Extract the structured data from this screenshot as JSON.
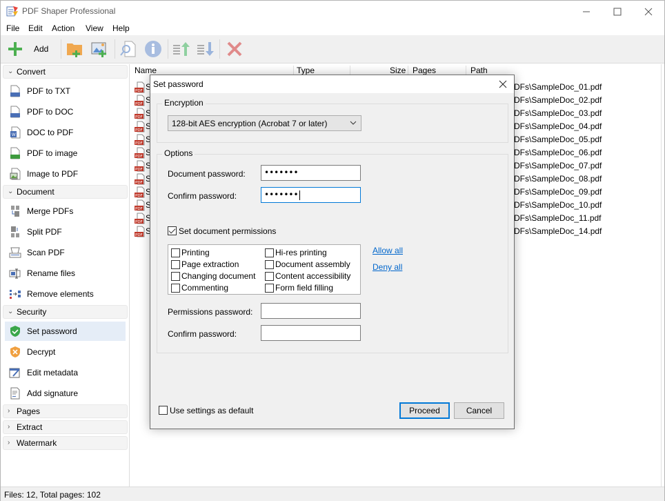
{
  "window": {
    "title": "PDF Shaper Professional",
    "controls": [
      "minimize",
      "maximize",
      "close"
    ]
  },
  "menu": [
    "File",
    "Edit",
    "Action",
    "View",
    "Help"
  ],
  "toolbar": {
    "add_label": "Add",
    "icons": [
      "add-icon",
      "add-folder-icon",
      "add-image-icon",
      "preview-icon",
      "info-icon",
      "move-up-icon",
      "move-down-icon",
      "remove-icon"
    ]
  },
  "sidebar": {
    "groups": [
      {
        "label": "Convert",
        "expanded": true,
        "items": [
          "PDF to TXT",
          "PDF to DOC",
          "DOC to PDF",
          "PDF to image",
          "Image to PDF"
        ]
      },
      {
        "label": "Document",
        "expanded": true,
        "items": [
          "Merge PDFs",
          "Split PDF",
          "Scan PDF",
          "Rename files",
          "Remove elements"
        ]
      },
      {
        "label": "Security",
        "expanded": true,
        "items": [
          "Set password",
          "Decrypt",
          "Edit metadata",
          "Add signature"
        ],
        "active": "Set password"
      },
      {
        "label": "Pages",
        "expanded": false
      },
      {
        "label": "Extract",
        "expanded": false
      },
      {
        "label": "Watermark",
        "expanded": false
      }
    ]
  },
  "filelist": {
    "columns": [
      "Name",
      "Type",
      "Size",
      "Pages",
      "Path"
    ],
    "rows": [
      {
        "name": "S",
        "path": "DFs\\SampleDoc_01.pdf"
      },
      {
        "name": "S",
        "path": "DFs\\SampleDoc_02.pdf"
      },
      {
        "name": "S",
        "path": "DFs\\SampleDoc_03.pdf"
      },
      {
        "name": "S",
        "path": "DFs\\SampleDoc_04.pdf"
      },
      {
        "name": "S",
        "path": "DFs\\SampleDoc_05.pdf"
      },
      {
        "name": "S",
        "path": "DFs\\SampleDoc_06.pdf"
      },
      {
        "name": "S",
        "path": "DFs\\SampleDoc_07.pdf"
      },
      {
        "name": "S",
        "path": "DFs\\SampleDoc_08.pdf"
      },
      {
        "name": "S",
        "path": "DFs\\SampleDoc_09.pdf"
      },
      {
        "name": "S",
        "path": "DFs\\SampleDoc_10.pdf"
      },
      {
        "name": "S",
        "path": "DFs\\SampleDoc_11.pdf"
      },
      {
        "name": "S",
        "path": "DFs\\SampleDoc_14.pdf"
      }
    ]
  },
  "status": {
    "text": "Files: 12, Total pages: 102"
  },
  "dialog": {
    "title": "Set password",
    "encryption": {
      "legend": "Encryption",
      "selected": "128-bit AES encryption (Acrobat 7 or later)"
    },
    "options": {
      "legend": "Options",
      "document_password_label": "Document password:",
      "document_password_value": "•••••••",
      "confirm_password_label": "Confirm password:",
      "confirm_password_value": "•••••••",
      "set_permissions_label": "Set document permissions",
      "set_permissions_checked": true,
      "permissions": [
        {
          "label": "Printing",
          "checked": false
        },
        {
          "label": "Page extraction",
          "checked": false
        },
        {
          "label": "Changing document",
          "checked": false
        },
        {
          "label": "Commenting",
          "checked": false
        },
        {
          "label": "Hi-res printing",
          "checked": false
        },
        {
          "label": "Document assembly",
          "checked": false
        },
        {
          "label": "Content accessibility",
          "checked": false
        },
        {
          "label": "Form field filling",
          "checked": false
        }
      ],
      "allow_all": "Allow all",
      "deny_all": "Deny all",
      "permissions_password_label": "Permissions password:",
      "permissions_password_value": "",
      "permissions_confirm_label": "Confirm password:",
      "permissions_confirm_value": ""
    },
    "use_default_label": "Use settings as default",
    "use_default_checked": false,
    "proceed_label": "Proceed",
    "cancel_label": "Cancel"
  },
  "colors": {
    "accent": "#0078d7",
    "link": "#0066cc",
    "pdf_red": "#c0392b",
    "add_green": "#4caf50"
  }
}
